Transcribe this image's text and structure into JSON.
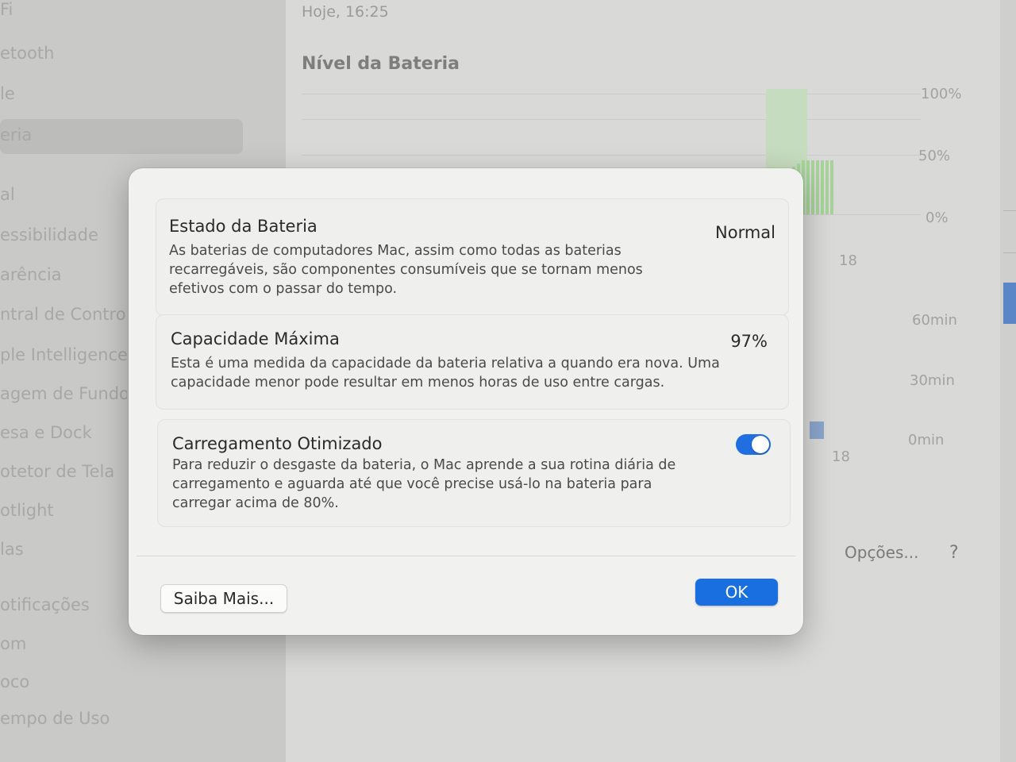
{
  "sidebar": {
    "items": [
      "Fi",
      "etooth",
      "le",
      "eria",
      "al",
      "essibilidade",
      "arência",
      "ntral de Contro",
      "ple Intelligence",
      "agem de Fundo",
      "esa e Dock",
      "otetor de Tela",
      "otlight",
      "las",
      "otificações",
      "om",
      "oco",
      "empo de Uso"
    ]
  },
  "main": {
    "date": "Hoje, 16:25",
    "level_title": "Nível da Bateria",
    "level_axis": [
      "100%",
      "50%",
      "0%"
    ],
    "level_x_label": "18",
    "usage_axis": [
      "60min",
      "30min",
      "0min"
    ],
    "usage_x_label": "18",
    "options_button": "Opções...",
    "help_button": "?"
  },
  "dialog": {
    "battery_state": {
      "title": "Estado da Bateria",
      "value": "Normal",
      "description": "As baterias de computadores Mac, assim como todas as baterias recarregáveis, são componentes consumíveis que se tornam menos efetivos com o passar do tempo."
    },
    "max_capacity": {
      "title": "Capacidade Máxima",
      "value": "97%",
      "description": "Esta é uma medida da capacidade da bateria relativa a quando era nova. Uma capacidade menor pode resultar em menos horas de uso entre cargas."
    },
    "optimized_charging": {
      "title": "Carregamento Otimizado",
      "enabled": true,
      "description": "Para reduzir o desgaste da bateria, o Mac aprende a sua rotina diária de carregamento e aguarda até que você precise usá-lo na bateria para carregar acima de 80%."
    },
    "learn_more_button": "Saiba Mais...",
    "ok_button": "OK"
  },
  "colors": {
    "accent": "#1a6fe0",
    "battery_green": "#a7d39a"
  }
}
